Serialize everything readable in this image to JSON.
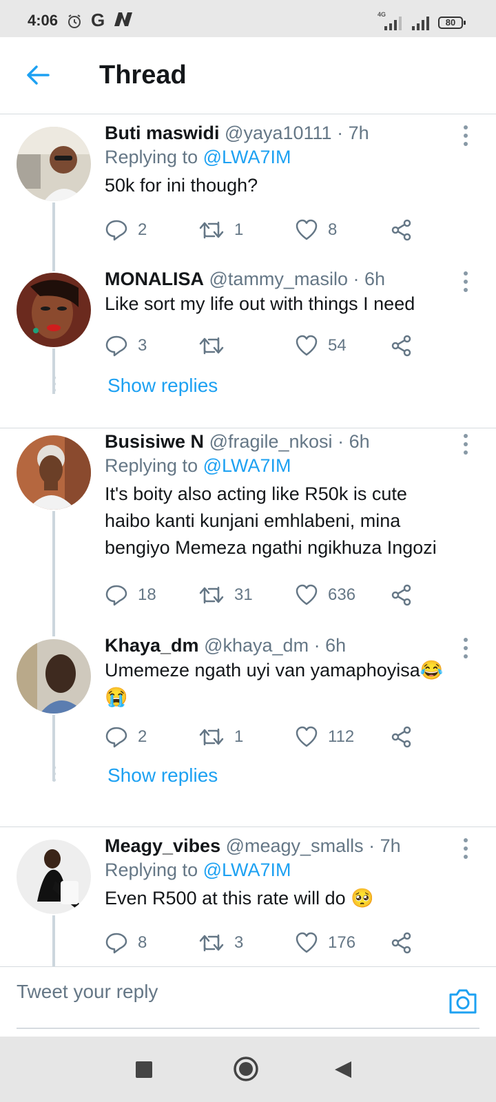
{
  "status_bar": {
    "time": "4:06",
    "carrier_g": "G",
    "network": "4G",
    "battery": "80"
  },
  "header": {
    "title": "Thread"
  },
  "tweets": [
    {
      "name": "Buti maswidi",
      "handle": "@yaya10111",
      "time": "· 7h",
      "replying_label": "Replying to",
      "replying_to": "@LWA7IM",
      "text": "50k for ini though?",
      "replies": "2",
      "retweets": "1",
      "likes": "8"
    },
    {
      "name": "MONALISA",
      "handle": "@tammy_masilo",
      "time": "· 6h",
      "text": "Like sort my life out with things I need",
      "replies": "3",
      "retweets": "",
      "likes": "54",
      "show_replies": "Show replies"
    },
    {
      "name": "Busisiwe N",
      "handle": "@fragile_nkosi",
      "time": "· 6h",
      "replying_label": "Replying to",
      "replying_to": "@LWA7IM",
      "text_lines": [
        "It's boity also acting like R50k is cute",
        "haibo kanti kunjani emhlabeni, mina",
        "bengiyo Memeza ngathi ngikhuza Ingozi"
      ],
      "replies": "18",
      "retweets": "31",
      "likes": "636"
    },
    {
      "name": "Khaya_dm",
      "handle": "@khaya_dm",
      "time": "· 6h",
      "text": "Umemeze ngath uyi van yamaphoyisa😂",
      "text2": "😭",
      "replies": "2",
      "retweets": "1",
      "likes": "112",
      "show_replies": "Show replies"
    },
    {
      "name": "Meagy_vibes",
      "handle": "@meagy_smalls",
      "time": "· 7h",
      "replying_label": "Replying to",
      "replying_to": "@LWA7IM",
      "text": "Even R500 at this rate will do 🥺",
      "replies": "8",
      "retweets": "3",
      "likes": "176"
    }
  ],
  "reply_bar": {
    "placeholder": "Tweet your reply"
  },
  "colors": {
    "accent": "#1da1f2",
    "secondary_text": "#657786",
    "divider": "#d6dbdf"
  }
}
